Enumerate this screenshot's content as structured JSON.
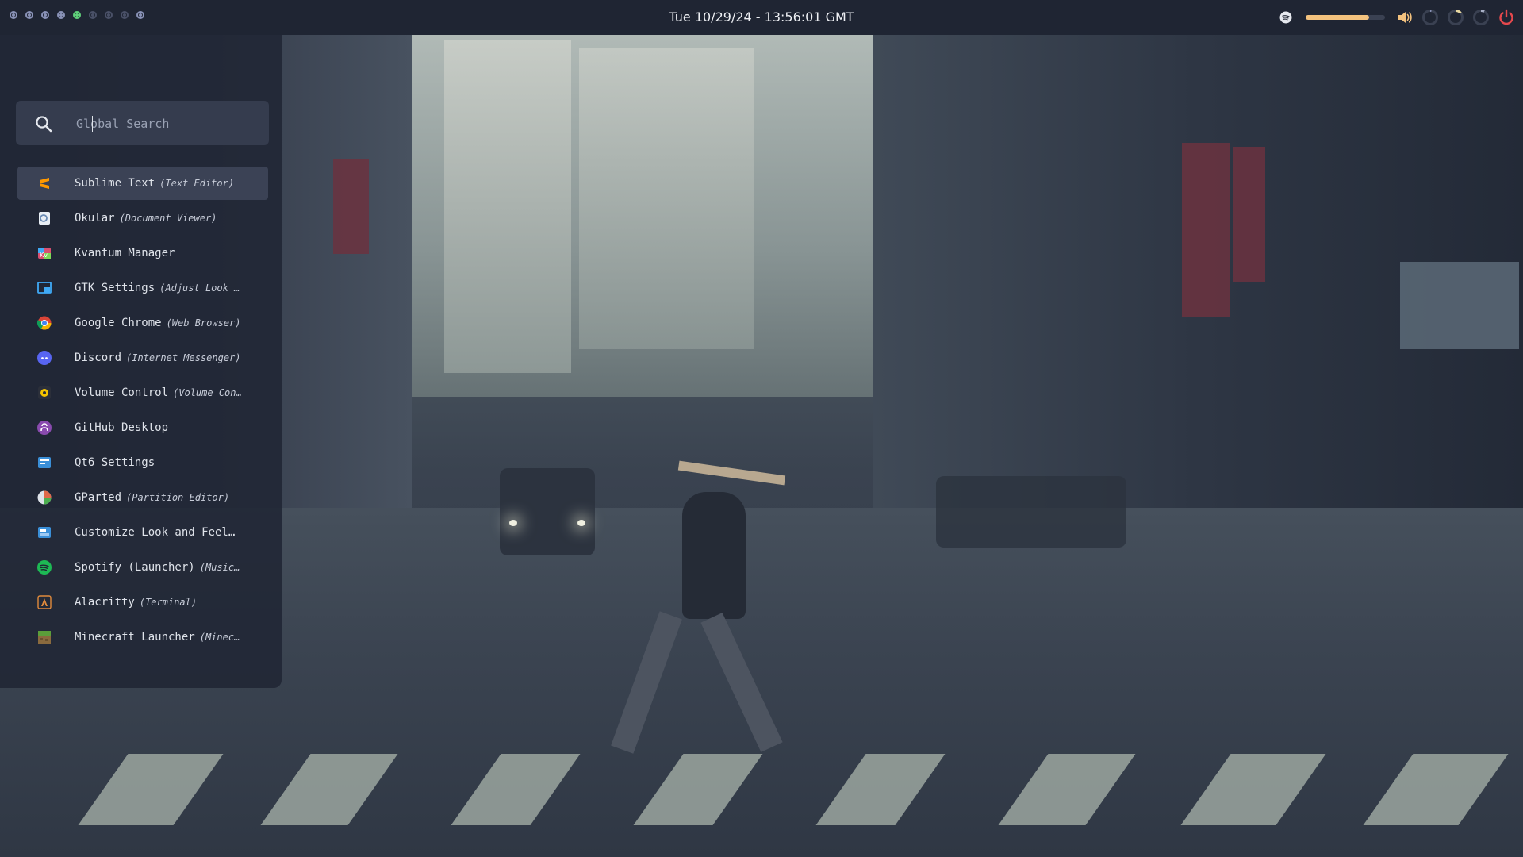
{
  "topbar": {
    "workspaces": [
      "inactive",
      "inactive",
      "inactive",
      "inactive",
      "active",
      "empty",
      "empty",
      "empty",
      "inactive"
    ],
    "clock": "Tue 10/29/24 - 13:56:01 GMT",
    "volume_level": 0.8,
    "tray_icons": [
      "spotify-icon",
      "volume-slider",
      "speaker-icon",
      "cpu-ring-icon",
      "memory-ring-icon",
      "disk-ring-icon",
      "power-icon"
    ],
    "colors": {
      "accent": "#5fd07a",
      "volume": "#f3c27e",
      "power": "#e5484d"
    }
  },
  "launcher": {
    "search": {
      "placeholder": "Global Search",
      "value": ""
    },
    "apps": [
      {
        "name": "Sublime Text",
        "desc": "(Text Editor)",
        "icon": "sublime-text-icon",
        "selected": true
      },
      {
        "name": "Okular",
        "desc": "(Document Viewer)",
        "icon": "okular-icon"
      },
      {
        "name": "Kvantum Manager",
        "desc": "",
        "icon": "kvantum-icon"
      },
      {
        "name": "GTK Settings",
        "desc": "(Adjust Look …",
        "icon": "gtk-settings-icon"
      },
      {
        "name": "Google Chrome",
        "desc": "(Web Browser)",
        "icon": "chrome-icon"
      },
      {
        "name": "Discord",
        "desc": "(Internet Messenger)",
        "icon": "discord-icon"
      },
      {
        "name": "Volume Control",
        "desc": "(Volume Con…",
        "icon": "volume-control-icon"
      },
      {
        "name": "GitHub Desktop",
        "desc": "",
        "icon": "github-icon"
      },
      {
        "name": "Qt6 Settings",
        "desc": "",
        "icon": "qt6-settings-icon"
      },
      {
        "name": "GParted",
        "desc": "(Partition Editor)",
        "icon": "gparted-icon"
      },
      {
        "name": "Customize Look and Feel…",
        "desc": "",
        "icon": "customize-look-icon"
      },
      {
        "name": "Spotify (Launcher)",
        "desc": "(Music…",
        "icon": "spotify-app-icon"
      },
      {
        "name": "Alacritty",
        "desc": "(Terminal)",
        "icon": "alacritty-icon"
      },
      {
        "name": "Minecraft Launcher",
        "desc": "(Minec…",
        "icon": "minecraft-icon"
      }
    ]
  }
}
